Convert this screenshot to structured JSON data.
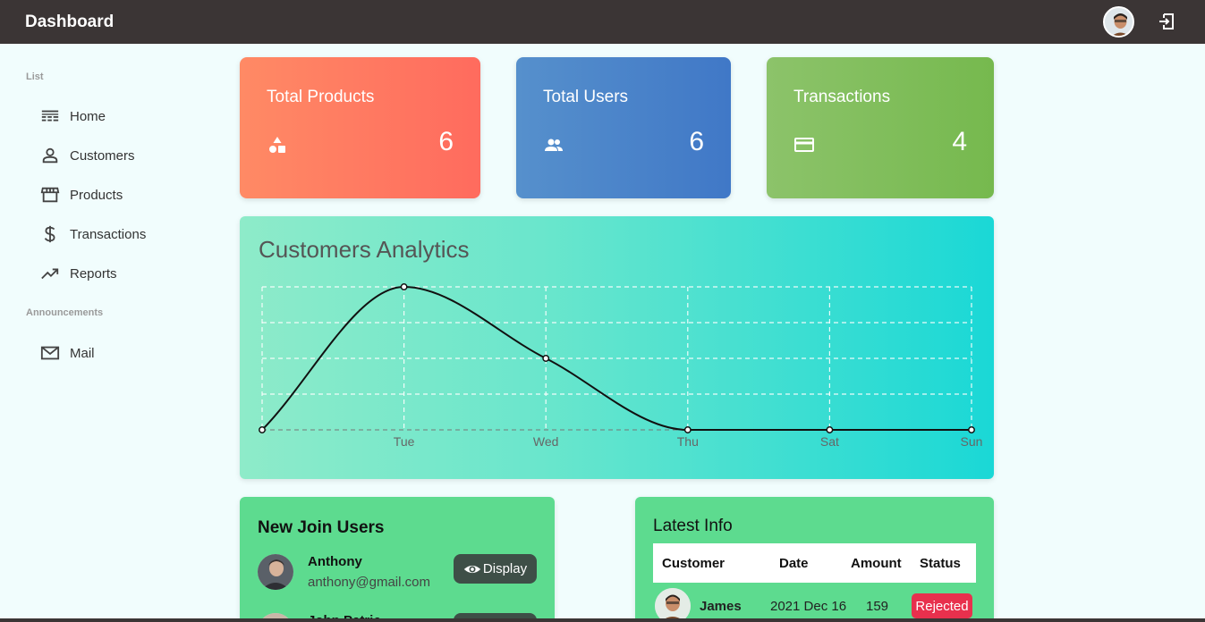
{
  "app": {
    "title": "Dashboard"
  },
  "sidebar": {
    "sections": [
      {
        "label": "List"
      },
      {
        "label": "Announcements"
      }
    ],
    "items": [
      {
        "label": "Home",
        "icon": "list-icon"
      },
      {
        "label": "Customers",
        "icon": "person-icon"
      },
      {
        "label": "Products",
        "icon": "store-icon"
      },
      {
        "label": "Transactions",
        "icon": "dollar-icon"
      },
      {
        "label": "Reports",
        "icon": "trending-icon"
      },
      {
        "label": "Mail",
        "icon": "mail-icon"
      }
    ]
  },
  "cards": [
    {
      "title": "Total Products",
      "value": "6",
      "icon": "shapes-icon",
      "color": "#ff7a62"
    },
    {
      "title": "Total Users",
      "value": "6",
      "icon": "group-icon",
      "color": "#4a84c9"
    },
    {
      "title": "Transactions",
      "value": "4",
      "icon": "credit-card-icon",
      "color": "#82bd5c"
    }
  ],
  "analytics": {
    "title": "Customers Analytics"
  },
  "chart_data": {
    "type": "line",
    "categories": [
      "",
      "Tue",
      "Wed",
      "Thu",
      "Sat",
      "Sun"
    ],
    "values": [
      0,
      4,
      2,
      0,
      0,
      0
    ],
    "ylim": [
      0,
      4
    ],
    "grid": true
  },
  "new_users": {
    "title": "New Join Users",
    "button_label": "Display",
    "users": [
      {
        "name": "Anthony",
        "email": "anthony@gmail.com"
      },
      {
        "name": "John Patric",
        "email": ""
      }
    ]
  },
  "latest_info": {
    "title": "Latest Info",
    "columns": [
      "Customer",
      "Date",
      "Amount",
      "Status"
    ],
    "rows": [
      {
        "customer": "James",
        "date": "2021 Dec 16",
        "amount": "159",
        "status": "Rejected"
      }
    ]
  },
  "colors": {
    "topbar": "#3b3535",
    "panel": "#5ddb8f",
    "rejected": "#e8304d"
  }
}
